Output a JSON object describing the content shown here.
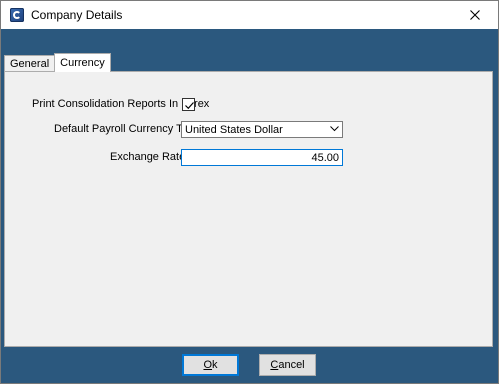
{
  "window": {
    "title": "Company Details",
    "icon": "app-icon",
    "close_icon": "close-icon"
  },
  "tabs": [
    {
      "label": "General",
      "active": false
    },
    {
      "label": "Currency",
      "active": true
    }
  ],
  "currency": {
    "print_consolidation": {
      "label": "Print Consolidation Reports In Forex",
      "checked": true
    },
    "payroll_currency": {
      "label": "Default Payroll Currency Type:",
      "value": "United States Dollar"
    },
    "exchange_rate": {
      "label": "Exchange Rate:",
      "value": "45.00"
    }
  },
  "buttons": {
    "ok": {
      "mnemonic": "O",
      "rest": "k"
    },
    "cancel": {
      "mnemonic": "C",
      "rest": "ancel"
    }
  },
  "colors": {
    "band": "#2b587e",
    "panel": "#f0f0f0",
    "focus": "#0078d7"
  }
}
